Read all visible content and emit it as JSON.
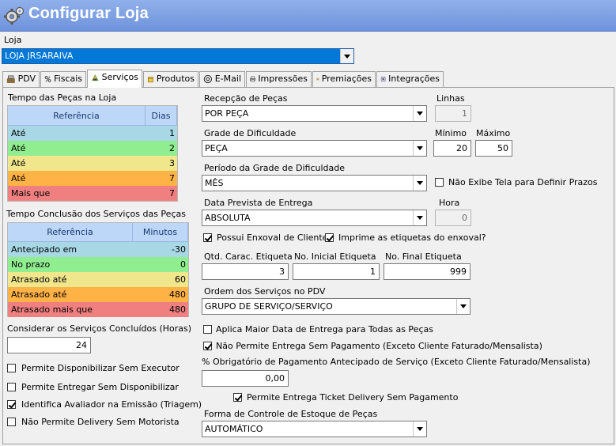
{
  "window": {
    "title": "Configurar Loja"
  },
  "loja": {
    "label": "Loja",
    "value": "LOJA JRSARAIVA"
  },
  "tabs": [
    {
      "label": "PDV",
      "icon": "cash-register-icon"
    },
    {
      "label": "Fiscais",
      "icon": "percent-icon"
    },
    {
      "label": "Serviços",
      "icon": "services-icon"
    },
    {
      "label": "Produtos",
      "icon": "box-icon"
    },
    {
      "label": "E-Mail",
      "icon": "at-sign-icon"
    },
    {
      "label": "Impressões",
      "icon": "printer-icon"
    },
    {
      "label": "Premiações",
      "icon": "award-icon"
    },
    {
      "label": "Integrações",
      "icon": "integration-icon"
    }
  ],
  "active_tab": "Serviços",
  "tempo_pecas": {
    "title": "Tempo das Peças na Loja",
    "headers": [
      "Referência",
      "Dias"
    ],
    "rows": [
      {
        "ref": "Até",
        "value": "1",
        "color": "#a8d8e6"
      },
      {
        "ref": "Até",
        "value": "2",
        "color": "#90ee90"
      },
      {
        "ref": "Até",
        "value": "3",
        "color": "#f0e68c"
      },
      {
        "ref": "Até",
        "value": "7",
        "color": "#ffb347"
      },
      {
        "ref": "Mais que",
        "value": "7",
        "color": "#f08080"
      }
    ]
  },
  "tempo_servicos": {
    "title": "Tempo Conclusão dos Serviços das Peças",
    "headers": [
      "Referência",
      "Minutos"
    ],
    "rows": [
      {
        "ref": "Antecipado em",
        "value": "-30",
        "color": "#a8d8e6"
      },
      {
        "ref": "No prazo",
        "value": "0",
        "color": "#90ee90"
      },
      {
        "ref": "Atrasado até",
        "value": "60",
        "color": "#f0e68c"
      },
      {
        "ref": "Atrasado até",
        "value": "480",
        "color": "#ffb347"
      },
      {
        "ref": "Atrasado mais que",
        "value": "480",
        "color": "#f08080"
      }
    ]
  },
  "concluidos": {
    "label": "Considerar os Serviços Concluídos (Horas)",
    "value": "24"
  },
  "left_checks": [
    {
      "label": "Permite Disponibilizar Sem Executor",
      "checked": false
    },
    {
      "label": "Permite Entregar Sem Disponibilizar",
      "checked": false
    },
    {
      "label": "Identifica Avaliador na Emissão (Triagem)",
      "checked": true
    },
    {
      "label": "Não Permite Delivery Sem Motorista",
      "checked": false
    }
  ],
  "recepcao": {
    "label": "Recepção de Peças",
    "value": "POR PEÇA"
  },
  "linhas": {
    "label": "Linhas",
    "value": "1"
  },
  "grade": {
    "label": "Grade de Dificuldade",
    "value": "PEÇA"
  },
  "minimo": {
    "label": "Mínimo",
    "value": "20"
  },
  "maximo": {
    "label": "Máximo",
    "value": "50"
  },
  "periodo": {
    "label": "Período da Grade de Dificuldade",
    "value": "MÊS"
  },
  "nao_exibe": {
    "label": "Não Exibe Tela para Definir Prazos",
    "checked": false
  },
  "data_prevista": {
    "label": "Data Prevista de Entrega",
    "value": "ABSOLUTA"
  },
  "hora": {
    "label": "Hora",
    "value": "0"
  },
  "enxoval": {
    "label": "Possui Enxoval de Cliente",
    "checked": true
  },
  "imprime": {
    "label": "Imprime as etiquetas do enxoval?",
    "checked": true
  },
  "qtd_carac": {
    "label": "Qtd. Carac. Etiqueta",
    "value": "3"
  },
  "no_inicial": {
    "label": "No. Inicial Etiqueta",
    "value": "1"
  },
  "no_final": {
    "label": "No. Final Etiqueta",
    "value": "999"
  },
  "ordem": {
    "label": "Ordem dos Serviços no PDV",
    "value": "GRUPO DE SERVIÇO/SERVIÇO"
  },
  "aplica_maior": {
    "label": "Aplica Maior Data de Entrega para Todas as Peças",
    "checked": false
  },
  "nao_permite_entrega": {
    "label": "Não Permite Entrega Sem Pagamento (Exceto Cliente Faturado/Mensalista)",
    "checked": true
  },
  "obrigatorio": {
    "label": "% Obrigatório de Pagamento Antecipado de Serviço (Exceto Cliente Faturado/Mensalista)",
    "value": "0,00"
  },
  "ticket_delivery": {
    "label": "Permite Entrega Ticket Delivery Sem Pagamento",
    "checked": true
  },
  "forma_controle": {
    "label": "Forma de Controle de Estoque de Peças",
    "value": "AUTOMÁTICO"
  }
}
